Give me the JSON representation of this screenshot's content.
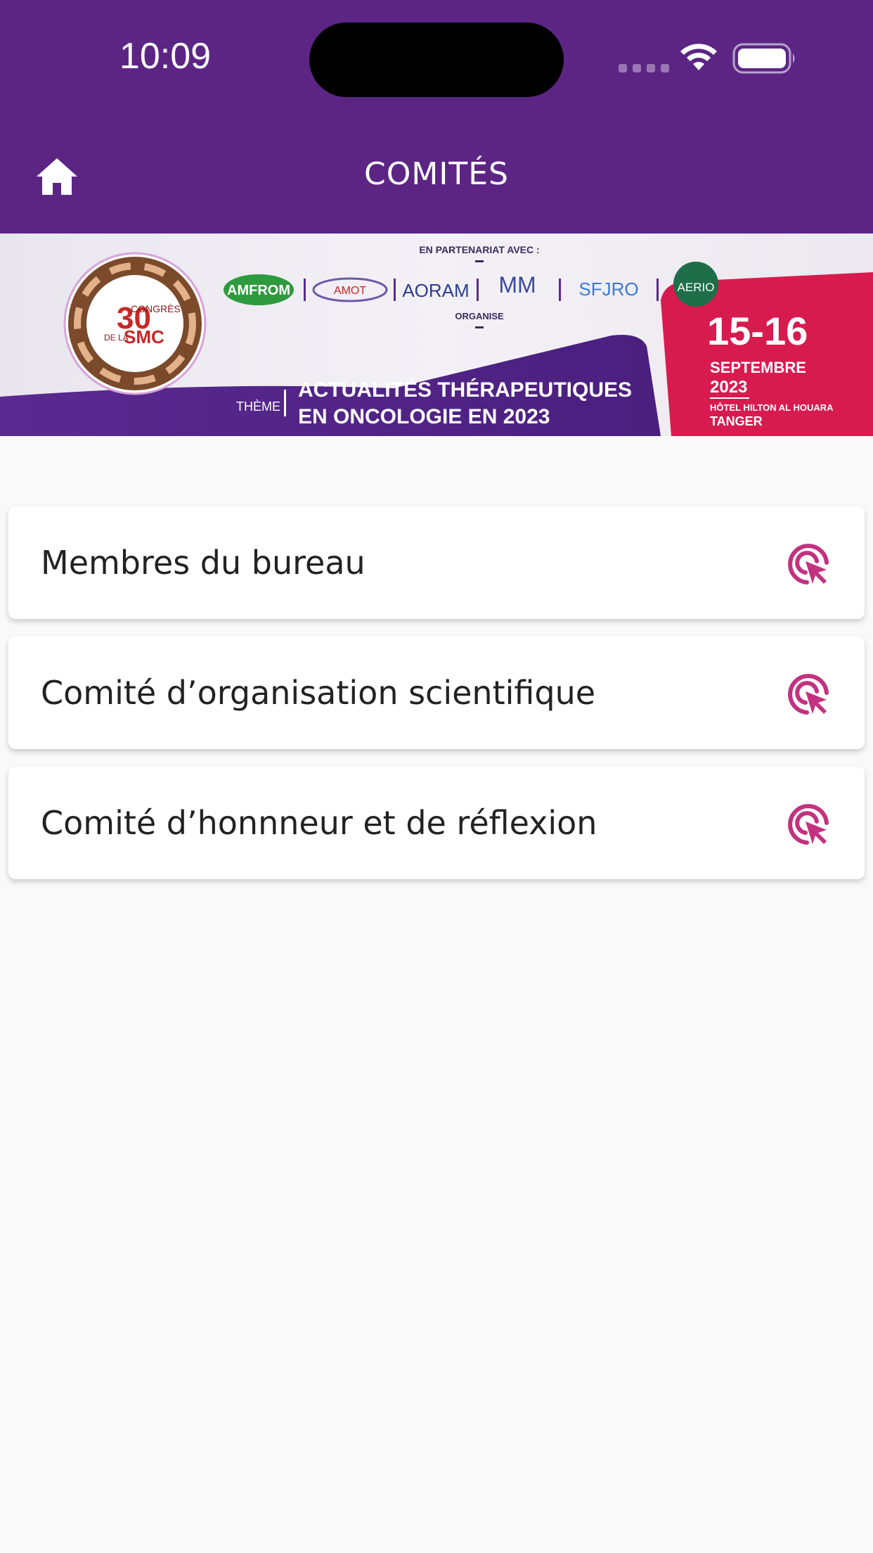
{
  "status_bar": {
    "time": "10:09"
  },
  "header": {
    "title": "COMITÉS",
    "home_icon": "home-icon",
    "background": "#5c2584"
  },
  "banner": {
    "partner_heading": "EN PARTENARIAT AVEC :",
    "organise": "ORGANISE",
    "logo_number": "30",
    "logo_congres": "CONGRÈS",
    "logo_dela": "DE LA",
    "logo_smc": "SMC",
    "partners": [
      "AMFROM",
      "AMOT",
      "AORAM",
      "MM",
      "SFJRO",
      "AERIO"
    ],
    "theme_label": "THÈME",
    "theme_line1": "ACTUALITÉS THÉRAPEUTIQUES",
    "theme_line2": "EN ONCOLOGIE EN 2023",
    "date_days": "15-16",
    "date_month": "SEPTEMBRE",
    "date_year": "2023",
    "venue": "HÔTEL HILTON AL HOUARA",
    "city": "TANGER"
  },
  "items": [
    {
      "label": "Membres du bureau",
      "icon": "pointer-click-icon"
    },
    {
      "label": "Comité d’organisation scientifique",
      "icon": "pointer-click-icon"
    },
    {
      "label": "Comité d’honnneur et de réflexion",
      "icon": "pointer-click-icon"
    }
  ],
  "colors": {
    "accent": "#c2327f",
    "primary": "#5c2584",
    "date_panel": "#d81b4f"
  }
}
